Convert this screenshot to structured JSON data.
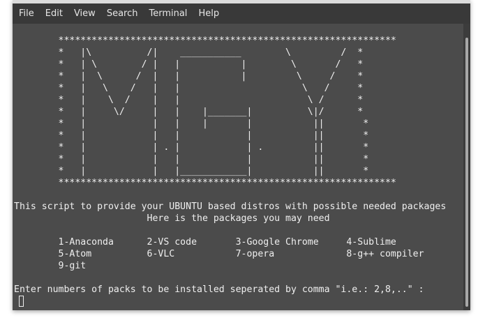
{
  "menubar": {
    "items": [
      "File",
      "Edit",
      "View",
      "Search",
      "Terminal",
      "Help"
    ]
  },
  "terminal": {
    "lines": [
      "        *************************************************************",
      "        *   |\\          /|    ___________        \\         /  *",
      "        *   | \\        / |   |           |        \\       /   *",
      "        *   |  \\      /  |   |           |         \\     /    *",
      "        *   |   \\    /   |   |                      \\   /     *",
      "        *   |    \\  /    |   |                       \\ /      *",
      "        *   |     \\/     |   |    |_______|          \\|/      *",
      "        *   |            |   |    |       |           ||       *",
      "        *   |            |   |            |           ||       *",
      "        *   |            | . |            | .         ||       *",
      "        *   |            |   |            |           ||       *",
      "        *   |            |   |____________|           ||       *",
      "        *************************************************************",
      "",
      "This script to provide your UBUNTU based distros with possible needed packages",
      "                        Here is the packages you may need",
      "",
      "        1-Anaconda      2-VS code       3-Google Chrome     4-Sublime",
      "        5-Atom          6-VLC           7-opera             8-g++ compiler",
      "        9-git",
      "",
      "Enter numbers of packs to be installed seperated by comma \"i.e.: 2,8,..\" :"
    ]
  }
}
